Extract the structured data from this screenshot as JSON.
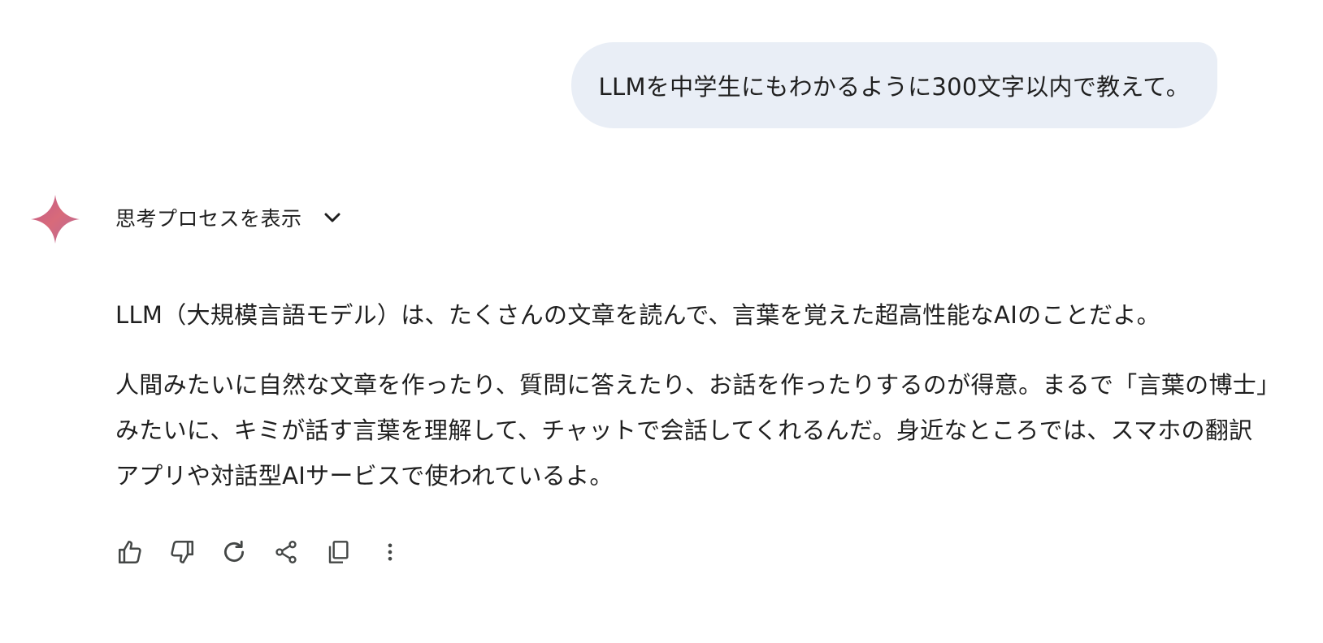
{
  "user_message": {
    "text": "LLMを中学生にもわかるように300文字以内で教えて。"
  },
  "assistant": {
    "logo_icon": "gemini-sparkle-icon",
    "thinking_toggle_label": "思考プロセスを表示",
    "paragraphs": [
      "LLM（大規模言語モデル）は、たくさんの文章を読んで、言葉を覚えた超高性能なAIのことだよ。",
      "人間みたいに自然な文章を作ったり、質問に答えたり、お話を作ったりするのが得意。まるで「言葉の博士」みたいに、キミが話す言葉を理解して、チャットで会話してくれるんだ。身近なところでは、スマホの翻訳アプリや対話型AIサービスで使われているよ。"
    ],
    "actions": [
      {
        "name": "thumbs-up",
        "icon": "thumbs-up-icon"
      },
      {
        "name": "thumbs-down",
        "icon": "thumbs-down-icon"
      },
      {
        "name": "regenerate",
        "icon": "refresh-icon"
      },
      {
        "name": "share",
        "icon": "share-icon"
      },
      {
        "name": "copy",
        "icon": "copy-icon"
      },
      {
        "name": "more",
        "icon": "more-vertical-icon"
      }
    ]
  },
  "colors": {
    "user_bubble_bg": "#e9eef6",
    "text": "#1f1f1f",
    "icon": "#444746"
  }
}
